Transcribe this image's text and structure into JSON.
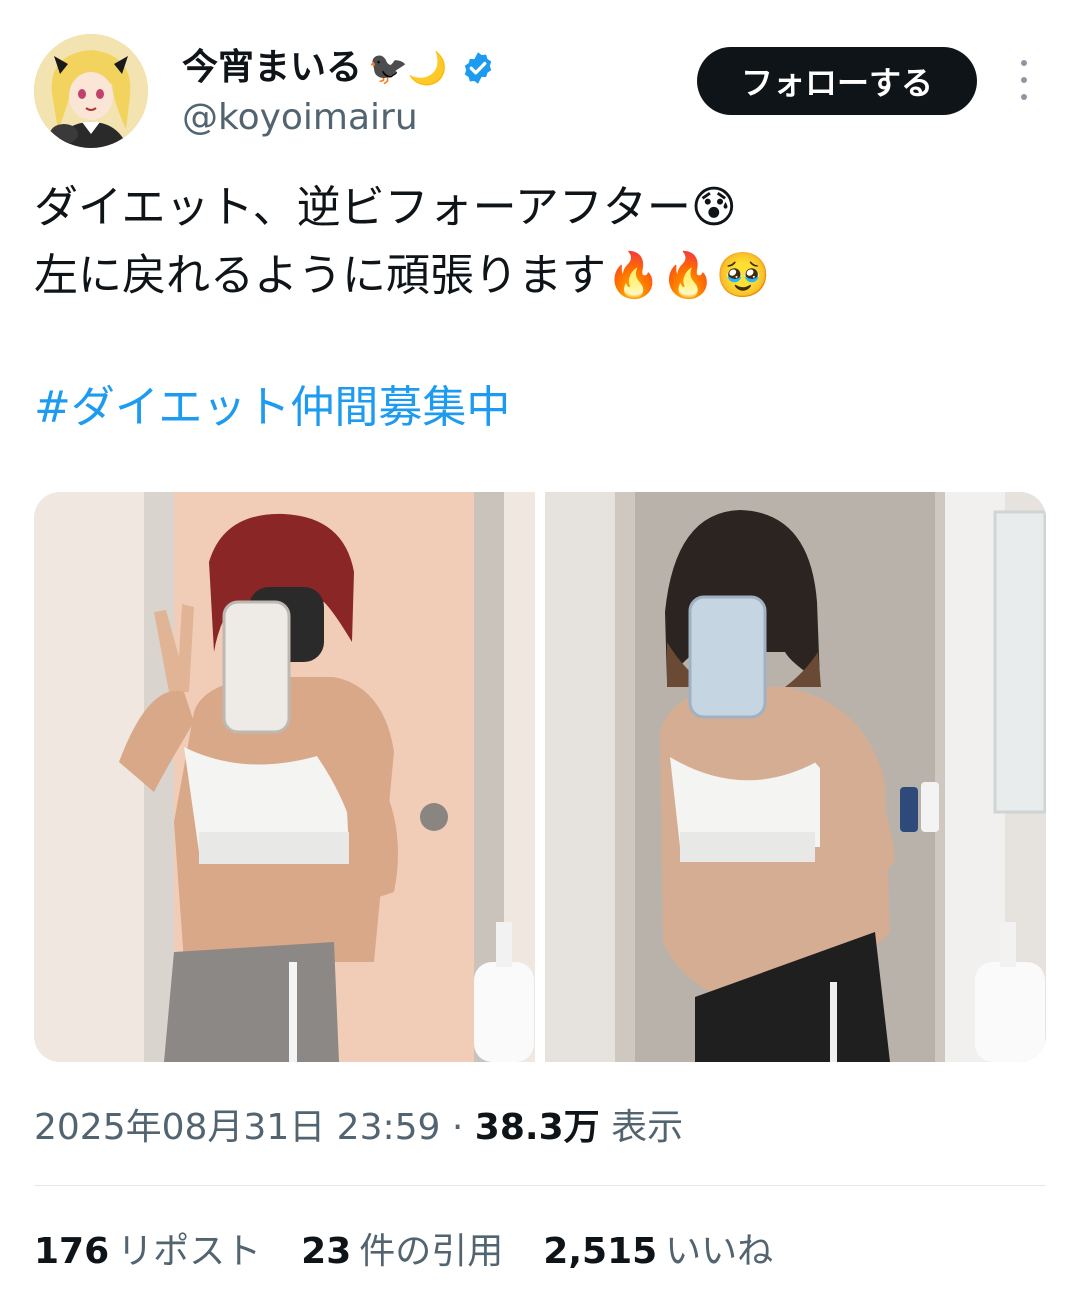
{
  "author": {
    "display_name": "今宵まいる",
    "name_emojis": "🐦‍⬛🌙",
    "handle": "@koyoimairu",
    "verified": true,
    "avatar_icon": "anime-avatar-icon"
  },
  "header": {
    "follow_label": "フォローする",
    "more_icon": "more-vertical-icon"
  },
  "tweet": {
    "line1": "ダイエット、逆ビフォーアフター😰",
    "line2": "左に戻れるように頑張ります🔥🔥🥹",
    "hashtag": "#ダイエット仲間募集中"
  },
  "media": {
    "photos": [
      "photo-before",
      "photo-after"
    ]
  },
  "meta": {
    "datetime": "2025年08月31日 23:59",
    "separator": "·",
    "views_count": "38.3万",
    "views_label": "表示"
  },
  "stats": {
    "reposts_count": "176",
    "reposts_label": "リポスト",
    "quotes_count": "23",
    "quotes_label": "件の引用",
    "likes_count": "2,515",
    "likes_label": "いいね"
  },
  "colors": {
    "link": "#1d9bf0",
    "secondary": "#536471",
    "button_bg": "#0f1419",
    "verified": "#1d9bf0"
  }
}
